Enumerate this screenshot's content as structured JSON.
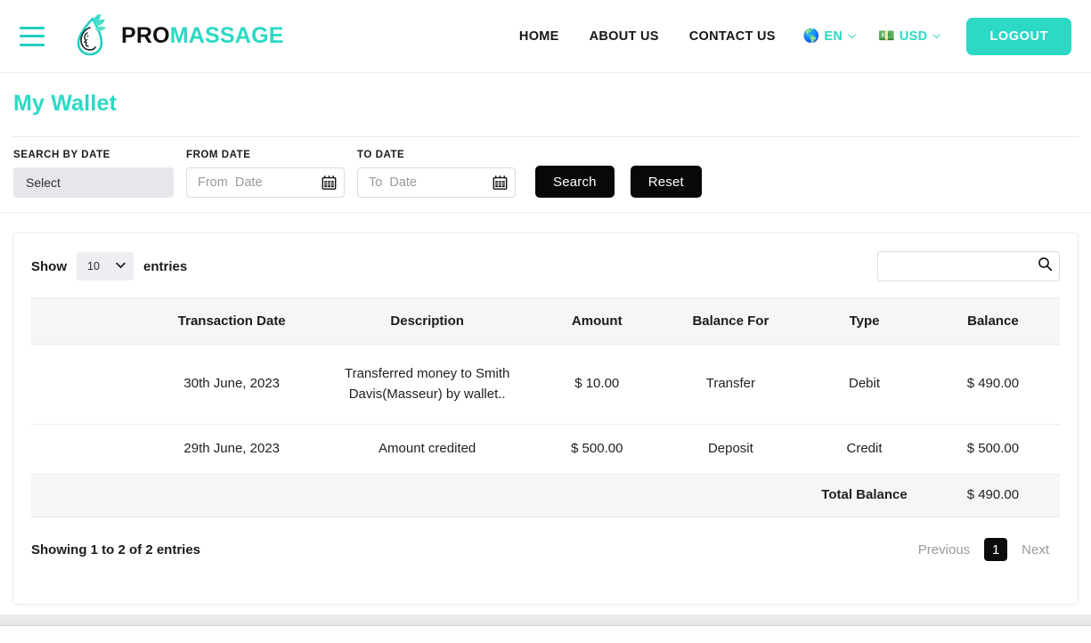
{
  "header": {
    "menu_icon": "hamburger-icon",
    "brand": {
      "part1": "PRO",
      "part2": "MASSAGE"
    },
    "nav": [
      {
        "label": "HOME"
      },
      {
        "label": "ABOUT US"
      },
      {
        "label": "CONTACT US"
      }
    ],
    "language": {
      "flag": "🌎",
      "code": "EN"
    },
    "currency": {
      "flag": "💵",
      "code": "USD"
    },
    "logout_label": "LOGOUT",
    "accent_color": "#2bd9c4"
  },
  "page": {
    "title": "My Wallet"
  },
  "filters": {
    "search_by_date": {
      "label": "SEARCH BY DATE",
      "value": "Select"
    },
    "from_date": {
      "label": "FROM DATE",
      "placeholder": "From  Date",
      "value": ""
    },
    "to_date": {
      "label": "TO DATE",
      "placeholder": "To  Date",
      "value": ""
    },
    "search_button": "Search",
    "reset_button": "Reset"
  },
  "table_controls": {
    "show_label": "Show",
    "entries_label": "entries",
    "page_length": "10",
    "search_placeholder": "",
    "search_value": ""
  },
  "table": {
    "columns": [
      "",
      "Transaction Date",
      "Description",
      "Amount",
      "Balance For",
      "Type",
      "Balance"
    ],
    "rows": [
      {
        "spacer": "",
        "date": "30th June, 2023",
        "description": "Transferred money to Smith Davis(Masseur) by wallet..",
        "amount": "$ 10.00",
        "balance_for": "Transfer",
        "type": "Debit",
        "balance": "$ 490.00"
      },
      {
        "spacer": "",
        "date": "29th June, 2023",
        "description": "Amount credited",
        "amount": "$ 500.00",
        "balance_for": "Deposit",
        "type": "Credit",
        "balance": "$ 500.00"
      }
    ],
    "total": {
      "label": "Total Balance",
      "value": "$ 490.00"
    }
  },
  "footer": {
    "showing": "Showing 1 to 2 of 2 entries",
    "previous": "Previous",
    "current_page": "1",
    "next": "Next"
  }
}
